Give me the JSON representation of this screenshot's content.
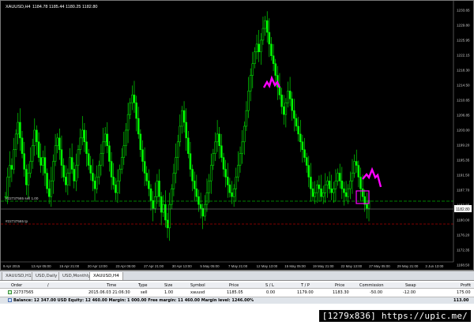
{
  "chart": {
    "title": "XAUUSD,H4",
    "ohlc": "1184.78  1185.44  1180.25  1182.80",
    "price_scale": [
      "1233.65",
      "1229.80",
      "1225.95",
      "1222.15",
      "1218.30",
      "1214.50",
      "1210.65",
      "1206.85",
      "1203.00",
      "1199.20",
      "1195.35",
      "1191.50",
      "1187.70",
      "1183.85",
      "1180.00",
      "1176.20",
      "1172.35",
      "1168.50"
    ],
    "current_price": "1182.80",
    "time_scale": [
      "9 Apr 2015",
      "13 Apr 05:00",
      "15 Apr 21:00",
      "20 Apr 13:00",
      "23 Apr 05:00",
      "27 Apr 21:00",
      "30 Apr 13:00",
      "5 May 05:00",
      "7 May 21:00",
      "12 May 13:00",
      "15 May 05:00",
      "19 May 21:00",
      "22 May 13:00",
      "27 May 05:00",
      "29 May 21:00",
      "3 Jun 13:00"
    ],
    "order_line_label": "#22737565 sell 1.00",
    "tp_line_label": "#22737565 tp",
    "candles": [
      1186,
      1191,
      1194,
      1193,
      1198,
      1202,
      1205,
      1201,
      1197,
      1193,
      1189,
      1192,
      1195,
      1199,
      1203,
      1200,
      1196,
      1194,
      1196,
      1192,
      1188,
      1186,
      1190,
      1195,
      1199,
      1201,
      1198,
      1194,
      1191,
      1189,
      1192,
      1196,
      1193,
      1190,
      1194,
      1198,
      1201,
      1203,
      1200,
      1197,
      1194,
      1192,
      1190,
      1188,
      1191,
      1194,
      1197,
      1200,
      1202,
      1199,
      1195,
      1191,
      1189,
      1187,
      1190,
      1193,
      1196,
      1199,
      1203,
      1207,
      1210,
      1212,
      1210,
      1206,
      1202,
      1198,
      1195,
      1192,
      1190,
      1188,
      1185,
      1183,
      1186,
      1190,
      1186,
      1182,
      1184,
      1180,
      1178,
      1184,
      1188,
      1192,
      1196,
      1200,
      1204,
      1208,
      1205,
      1201,
      1197,
      1193,
      1190,
      1188,
      1186,
      1184,
      1183,
      1181,
      1184,
      1187,
      1190,
      1194,
      1197,
      1200,
      1202,
      1199,
      1196,
      1193,
      1191,
      1189,
      1187,
      1186,
      1188,
      1191,
      1194,
      1197,
      1200,
      1204,
      1208,
      1213,
      1217,
      1220,
      1223,
      1225,
      1223,
      1226,
      1229,
      1231,
      1228,
      1225,
      1222,
      1220,
      1217,
      1214,
      1212,
      1209,
      1207,
      1210,
      1213,
      1211,
      1208,
      1206,
      1204,
      1202,
      1200,
      1198,
      1196,
      1194,
      1191,
      1188,
      1186,
      1187,
      1189,
      1188,
      1186,
      1187,
      1189,
      1190,
      1188,
      1187,
      1188,
      1190,
      1192,
      1190,
      1188,
      1187,
      1186,
      1188,
      1190,
      1192,
      1195,
      1194,
      1191,
      1188,
      1186,
      1184,
      1183,
      1185
    ]
  },
  "tabs": [
    "XAUUSD,H1",
    "USD,Daily",
    "USD,Monthly",
    "XAUUSD,H4"
  ],
  "active_tab": "XAUUSD,H4",
  "table": {
    "headers": [
      "Order",
      "/",
      "Time",
      "Type",
      "Size",
      "Symbol",
      "Price",
      "S / L",
      "T / P",
      "Price",
      "Commission",
      "Swap",
      "Profit"
    ],
    "order": [
      "22737565",
      "2015.06.03 21:06:30",
      "sell",
      "1.00",
      "xauusd",
      "1185.05",
      "0.00",
      "1179.00",
      "1183.30",
      "-50.00",
      "-12.00",
      "175.00"
    ],
    "balance_text": "Balance: 12 347.00 USD  Equity: 12 460.00  Margin: 1 000.00  Free margin: 11 460.00  Margin level: 1246.00%",
    "balance_total": "113.00"
  },
  "watermark": "[1279x836] https://upic.me/",
  "colors": {
    "candle": "#00ff00",
    "background": "#000000",
    "annotation": "#ff00ff",
    "sell_line": "#00ff00",
    "tp_line": "#ff0000"
  }
}
